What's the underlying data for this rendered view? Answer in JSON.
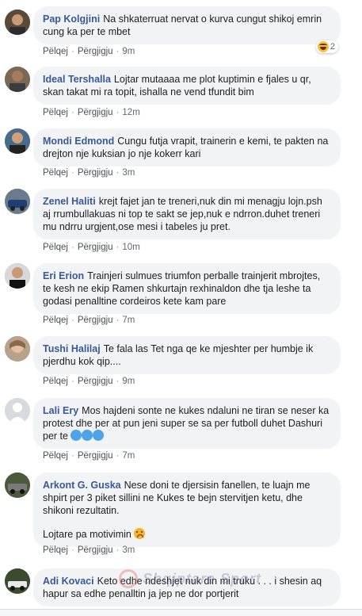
{
  "actions": {
    "like": "Pëlqej",
    "reply": "Përgjigju"
  },
  "comments": [
    {
      "name": "Pap Kolgjini",
      "text": "Na shkaterruat nervat o kurva cungut shikoj emrin cung ka per te mbet",
      "time": "9m",
      "reaction_count": "2"
    },
    {
      "name": "Ideal Tershalla",
      "text": "Lojtar mutaaaa me plot kuptimin e fjales u qr, skan takat mi ra topit, ishalla ne vend tfundit bim",
      "time": "12m"
    },
    {
      "name": "Mondi Edmond",
      "text": "Cungu futja vrapit, trainerin e kemi, te pakten na drejton nje kuksian jo nje kokerr kari",
      "time": "3m"
    },
    {
      "name": "Zenel Haliti",
      "text": "krejt fajet jan te treneri,nuk din mi menagju lojn.psh aj rrumbullakuas ni top te sakt se jep,nuk e ndrron.duhet treneri mu ndrru urgjent,ose mesi i tabeles ju pret.",
      "time": "10m"
    },
    {
      "name": "Eri Erion",
      "text": "Trainjeri sulmues triumfon perballe trainjerit mbrojtes, te kesh ne ekip Ramen shkurtajn rexhinaldon dhe tja leshe ta godasi penalltine cordeiros kete kam pare",
      "time": "7m"
    },
    {
      "name": "Tushi Halilaj",
      "text": "Te fala las Tet nga qe ke mjeshter per humbje ik pjerdhu kok qip....",
      "time": "9m"
    },
    {
      "name": "Lali Ery",
      "text": "Mos hajdeni sonte ne kukes ndaluni ne tiran se neser ka protest dhe per at pun jeni super se sa per futboll duhet Dashuri per te",
      "time": "7m"
    },
    {
      "name": "Arkont G. Guska",
      "text": "Nese doni te djersisin fanellen, te luajn me shpirt per 3 piket sillini ne Kukes te bejn stervitjen ketu, dhe shikoni rezultatin.",
      "extra": "Lojtare pa motivimin",
      "time": "3m"
    },
    {
      "name": "Adi Kovaci",
      "text": "Keto edhe ndeshjet nuk din mi truku . . . i shesin aq hapur sa edhe penalltin ja jep ne dor portjerit"
    }
  ],
  "watermark": "Shqiptare Sport"
}
